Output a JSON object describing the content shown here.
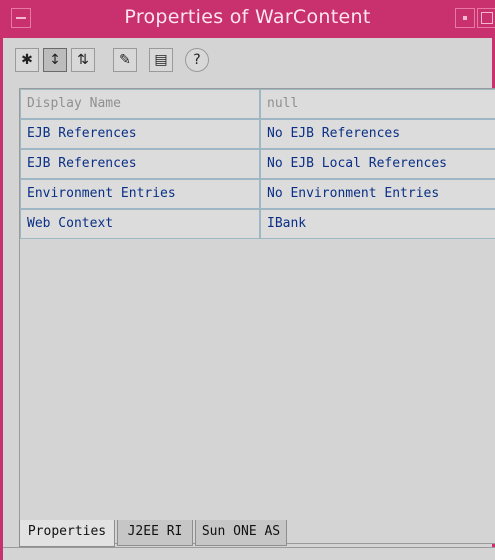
{
  "window": {
    "title": "Properties of WarContent"
  },
  "toolbar": {
    "buttons": [
      {
        "icon": "sort-by-category-icon",
        "glyph": "✱",
        "pressed": false
      },
      {
        "icon": "sort-by-name-icon",
        "glyph": "↕",
        "pressed": true
      },
      {
        "icon": "sort-by-type-icon",
        "glyph": "⇅",
        "pressed": false
      },
      {
        "icon": "show-editable-icon",
        "glyph": "✎",
        "pressed": false
      },
      {
        "icon": "customizer-icon",
        "glyph": "▤",
        "pressed": false
      },
      {
        "icon": "help-icon",
        "glyph": "?",
        "pressed": false
      }
    ]
  },
  "properties": [
    {
      "name": "Display Name",
      "value": "null",
      "disabled": true
    },
    {
      "name": "EJB References",
      "value": "No EJB References",
      "disabled": false
    },
    {
      "name": "EJB References",
      "value": "No EJB Local References",
      "disabled": false
    },
    {
      "name": "Environment Entries",
      "value": "No Environment Entries",
      "disabled": false
    },
    {
      "name": "Web Context",
      "value": "IBank",
      "disabled": false
    }
  ],
  "tabs": [
    {
      "label": "Properties",
      "active": true
    },
    {
      "label": "J2EE RI",
      "active": false
    },
    {
      "label": "Sun ONE AS",
      "active": false
    }
  ]
}
